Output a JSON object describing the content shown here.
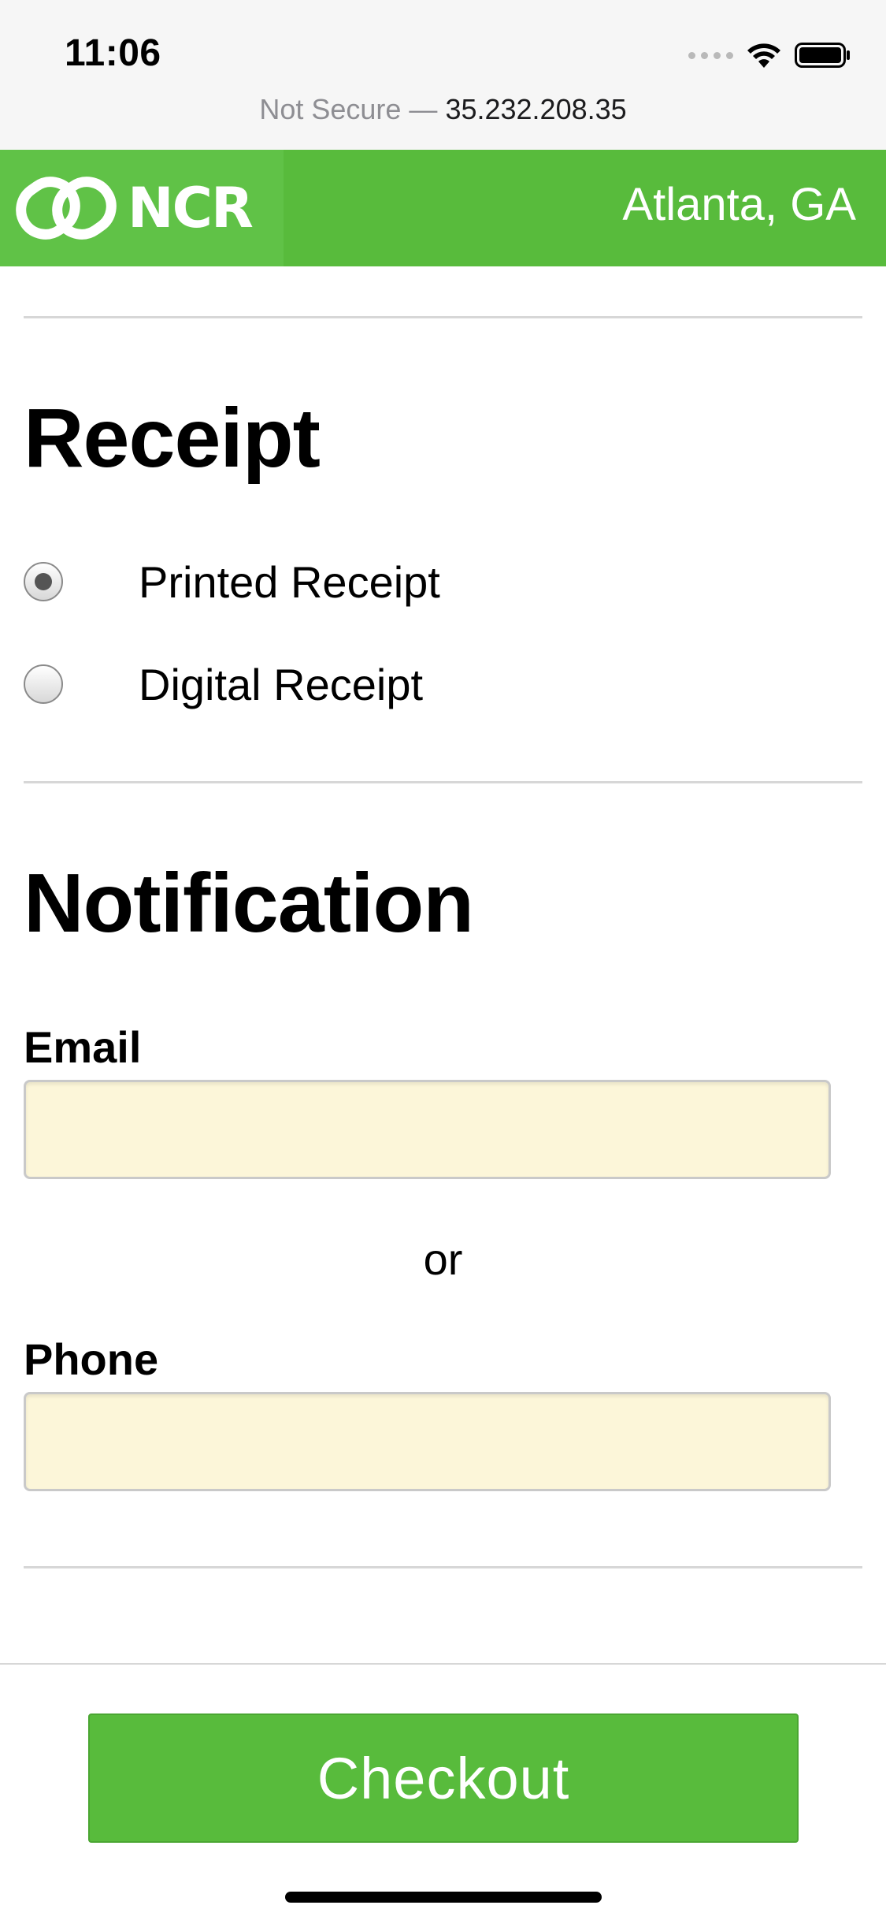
{
  "status_bar": {
    "time": "11:06",
    "icons": [
      "cellular-signal-icon",
      "wifi-icon",
      "battery-icon"
    ]
  },
  "browser": {
    "security_label": "Not Secure —",
    "host": "35.232.208.35"
  },
  "header": {
    "logo_text": "NCR",
    "location": "Atlanta, GA",
    "brand_color": "#58bb3c"
  },
  "receipt": {
    "title": "Receipt",
    "options": [
      {
        "label": "Printed Receipt",
        "selected": true
      },
      {
        "label": "Digital Receipt",
        "selected": false
      }
    ]
  },
  "notification": {
    "title": "Notification",
    "email_label": "Email",
    "email_value": "",
    "separator": "or",
    "phone_label": "Phone",
    "phone_value": "",
    "input_color": "#fcf6d9"
  },
  "checkout": {
    "label": "Checkout"
  }
}
